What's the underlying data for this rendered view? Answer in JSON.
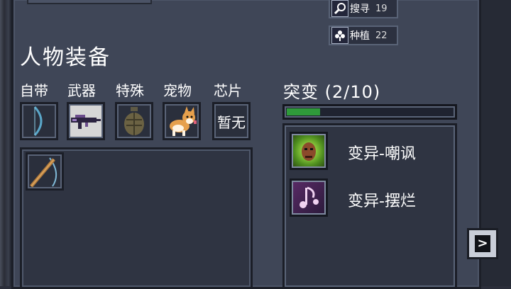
{
  "stats": [
    {
      "icon": "magnifier-icon",
      "label": "搜寻",
      "value": "19"
    },
    {
      "icon": "plant-icon",
      "label": "种植",
      "value": "22"
    }
  ],
  "equipment": {
    "title": "人物装备",
    "tabs": [
      "自带",
      "武器",
      "特殊",
      "宠物",
      "芯片"
    ],
    "slots": [
      {
        "name": "bow",
        "text": ""
      },
      {
        "name": "rifle",
        "text": ""
      },
      {
        "name": "grenade",
        "text": ""
      },
      {
        "name": "corgi-pet",
        "text": ""
      },
      {
        "name": "chip",
        "text": "暂无"
      }
    ],
    "inventory_items": [
      "bow-and-staff"
    ]
  },
  "mutation": {
    "title": "突变 (2/10)",
    "progress": 0.2,
    "items": [
      {
        "icon": "mocking-face-icon",
        "name": "变异-嘲讽"
      },
      {
        "icon": "music-note-icon",
        "name": "变异-摆烂"
      }
    ]
  },
  "next_button": {
    "glyph": ">"
  },
  "colors": {
    "panel": "#3f4657",
    "progress": "#2f9a3a",
    "chip_text": "#ffffff"
  }
}
